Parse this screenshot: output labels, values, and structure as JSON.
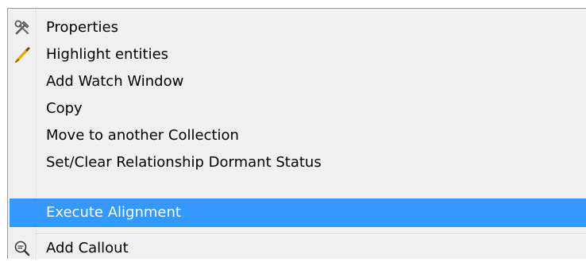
{
  "context_menu": {
    "items": [
      {
        "label": "Properties",
        "icon": "tools-icon"
      },
      {
        "label": "Highlight entities",
        "icon": "highlighter-pen-icon"
      },
      {
        "label": "Add Watch Window",
        "icon": ""
      },
      {
        "label": "Copy",
        "icon": ""
      },
      {
        "label": "Move to another Collection",
        "icon": ""
      },
      {
        "label": "Set/Clear Relationship Dormant Status",
        "icon": ""
      },
      {
        "label": "Execute Alignment",
        "icon": "",
        "highlighted": true
      },
      {
        "label": "Add Callout",
        "icon": "callout-magnifier-icon"
      }
    ],
    "highlight_color": "#3399ff",
    "background_color": "#f0f0f0"
  }
}
